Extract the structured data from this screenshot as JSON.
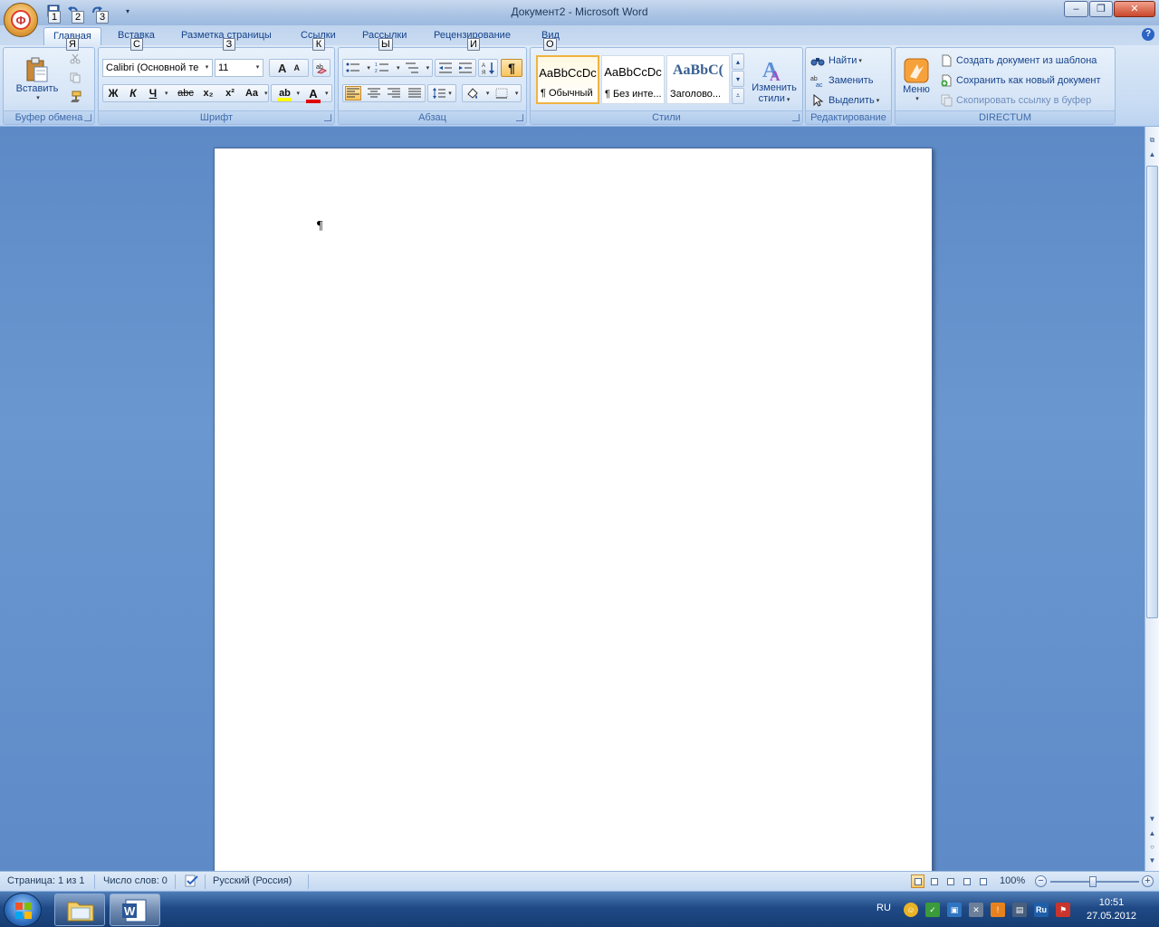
{
  "window": {
    "title": "Документ2 - Microsoft Word",
    "minimize": "–",
    "restore": "❐",
    "close": "✕"
  },
  "office_button": {
    "glyph": "Ф"
  },
  "keytips": [
    "1",
    "2",
    "3",
    "Я",
    "С",
    "З",
    "К",
    "Ы",
    "И",
    "О"
  ],
  "tabs": [
    {
      "label": "Главная",
      "active": true
    },
    {
      "label": "Вставка"
    },
    {
      "label": "Разметка страницы"
    },
    {
      "label": "Ссылки"
    },
    {
      "label": "Рассылки"
    },
    {
      "label": "Рецензирование"
    },
    {
      "label": "Вид"
    }
  ],
  "help": "?",
  "ribbon": {
    "clipboard": {
      "paste_label": "Вставить",
      "group_label": "Буфер обмена"
    },
    "font": {
      "font_name": "Calibri (Основной те",
      "font_size": "11",
      "grow": "A",
      "shrink": "A",
      "bold": "Ж",
      "italic": "К",
      "underline": "Ч",
      "strike": "abc",
      "subscript": "x₂",
      "superscript": "x²",
      "change_case": "Aa",
      "highlight": "ab",
      "font_color": "A",
      "group_label": "Шрифт"
    },
    "paragraph": {
      "show_marks": "¶",
      "group_label": "Абзац"
    },
    "styles": {
      "items": [
        {
          "sample": "AaBbCcDc",
          "name": "¶ Обычный"
        },
        {
          "sample": "AaBbCcDc",
          "name": "¶ Без инте..."
        },
        {
          "sample": "AaBbC(",
          "name": "Заголово..."
        }
      ],
      "change_styles": "Изменить",
      "change_styles_2": "стили",
      "group_label": "Стили"
    },
    "editing": {
      "find": "Найти",
      "replace": "Заменить",
      "select": "Выделить",
      "group_label": "Редактирование"
    },
    "directum": {
      "menu": "Меню",
      "create_from_template": "Создать документ из шаблона",
      "save_as_new": "Сохранить как новый документ",
      "copy_link": "Скопировать ссылку в буфер",
      "group_label": "DIRECTUM"
    }
  },
  "document": {
    "pilcrow": "¶"
  },
  "statusbar": {
    "page": "Страница: 1 из 1",
    "words": "Число слов: 0",
    "language": "Русский (Россия)",
    "zoom": "100%",
    "zoom_level_percent": 100
  },
  "taskbar": {
    "lang": "RU",
    "time": "10:51",
    "date": "27.05.2012"
  },
  "colors": {
    "accent": "#15428b",
    "highlight_bar": "#ffff00",
    "font_color_bar": "#e00000",
    "selected_border": "#f0b341"
  }
}
